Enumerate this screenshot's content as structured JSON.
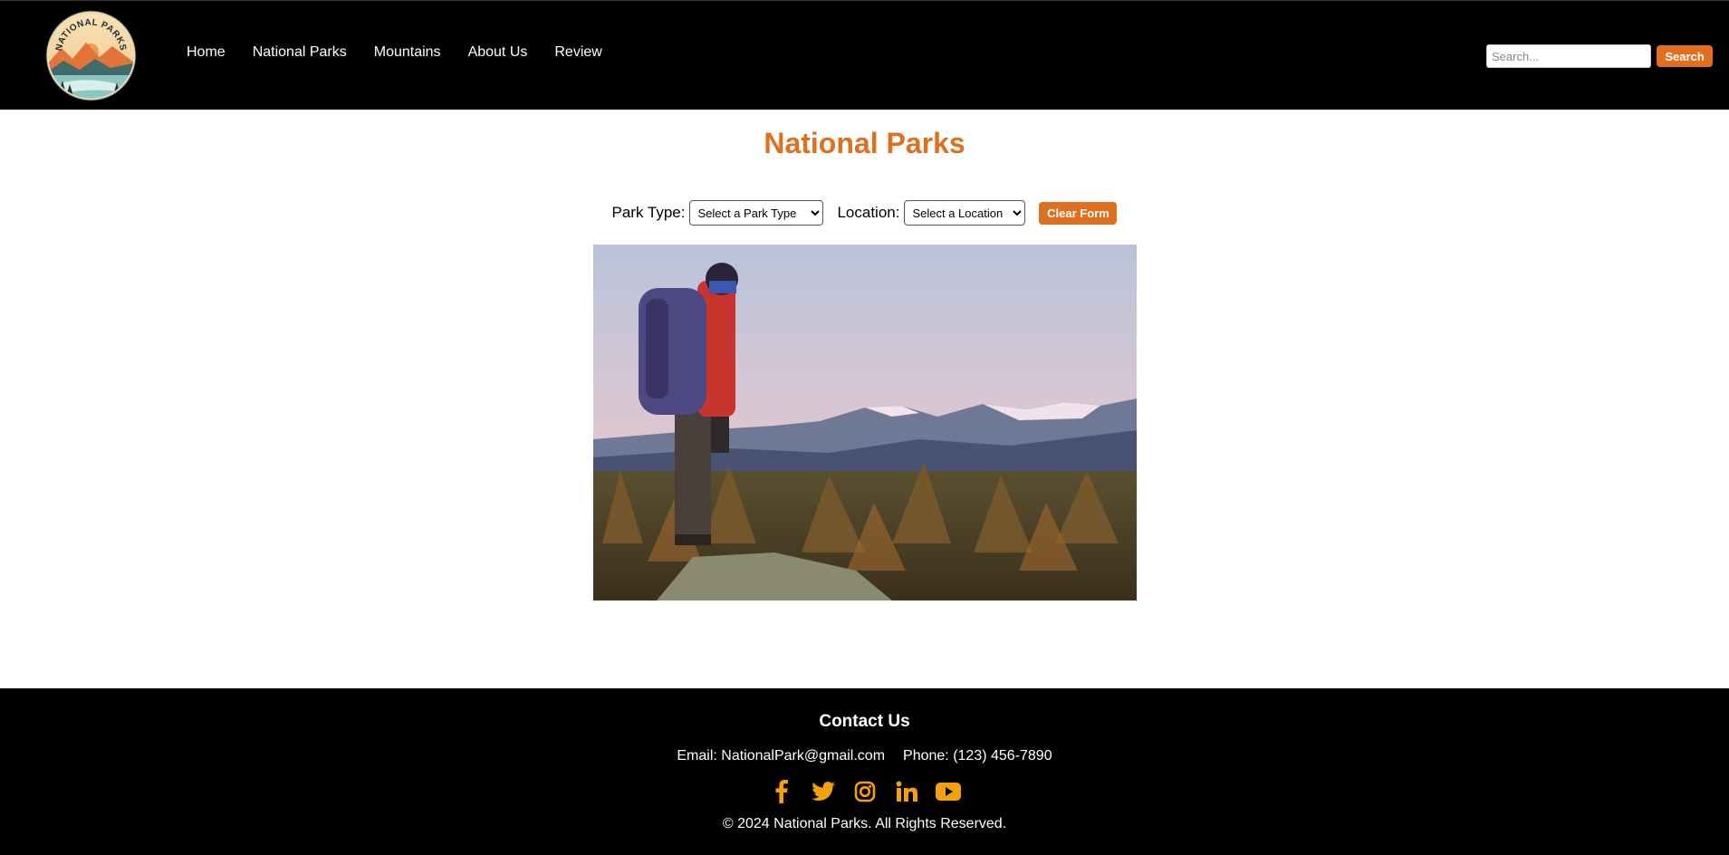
{
  "header": {
    "logo_text": "NATIONAL PARKS",
    "nav": [
      {
        "label": "Home"
      },
      {
        "label": "National Parks"
      },
      {
        "label": "Mountains"
      },
      {
        "label": "About Us"
      },
      {
        "label": "Review"
      }
    ],
    "search": {
      "placeholder": "Search...",
      "value": "",
      "button_label": "Search"
    }
  },
  "main": {
    "title": "National Parks",
    "filters": {
      "park_type_label": "Park Type:",
      "park_type_selected": "Select a Park Type",
      "location_label": "Location:",
      "location_selected": "Select a Location",
      "clear_label": "Clear Form"
    },
    "hero_image": "hiker-with-backpack-overlooking-snowy-mountains"
  },
  "footer": {
    "title": "Contact Us",
    "email": "Email: NationalPark@gmail.com",
    "phone": "Phone: (123) 456-7890",
    "socials": [
      "facebook-icon",
      "twitter-icon",
      "instagram-icon",
      "linkedin-icon",
      "youtube-icon"
    ],
    "copyright": "© 2024 National Parks. All Rights Reserved."
  },
  "colors": {
    "accent": "#e07020",
    "header_bg": "#000000",
    "footer_bg": "#000000",
    "social_icon": "#f5a00f"
  }
}
